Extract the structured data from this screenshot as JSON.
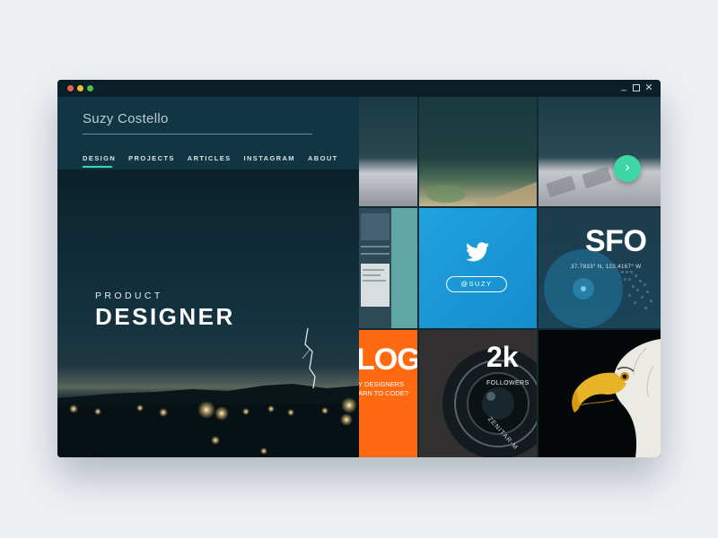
{
  "profile": {
    "name": "Suzy Costello"
  },
  "nav": {
    "items": [
      {
        "label": "DESIGN",
        "active": true
      },
      {
        "label": "PROJECTS"
      },
      {
        "label": "ARTICLES"
      },
      {
        "label": "INSTAGRAM"
      },
      {
        "label": "ABOUT"
      }
    ]
  },
  "hero": {
    "subtitle": "PRODUCT",
    "title": "DESIGNER"
  },
  "tiles": {
    "twitter": {
      "handle": "@SUZY",
      "icon": "twitter-bird-icon"
    },
    "location": {
      "code": "SFO",
      "coords": "37.7833° N, 122.4167° W"
    },
    "followers": {
      "count": "2k",
      "label": "FOLLOWERS"
    },
    "blog": {
      "title": "LOG",
      "line1": "Y DESIGNERS",
      "line2": "ARN TO CODE?"
    },
    "lens_text": "ZENITAR-M"
  },
  "window_controls": {
    "minimize": "_",
    "close": "✕"
  },
  "colors": {
    "accent": "#3dd8a8",
    "twitter": "#1d9bd8",
    "orange": "#ff6a10",
    "teal": "#5fa6a4",
    "background": "#0c2430"
  }
}
